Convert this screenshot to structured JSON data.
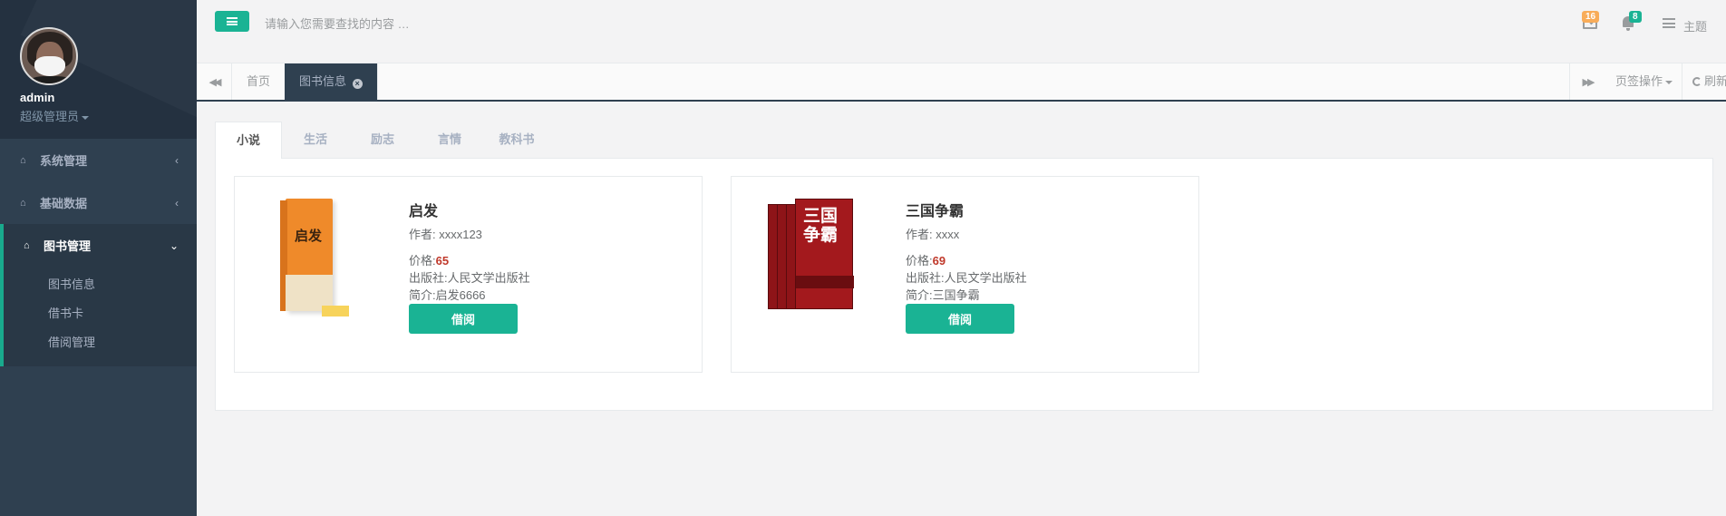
{
  "sidebar": {
    "user_name": "admin",
    "user_role": "超级管理员",
    "menu": [
      {
        "label": "系统管理"
      },
      {
        "label": "基础数据"
      },
      {
        "label": "图书管理",
        "sub_items": [
          "图书信息",
          "借书卡",
          "借阅管理"
        ]
      }
    ]
  },
  "topbar": {
    "search_placeholder": "请输入您需要查找的内容 …",
    "mail_count": "16",
    "notification_count": "8",
    "theme_label": "主题"
  },
  "tabbar": {
    "tabs": [
      "首页",
      "图书信息"
    ],
    "tab_ops_label": "页签操作",
    "refresh_label": "刷新"
  },
  "content": {
    "categories": [
      "小说",
      "生活",
      "励志",
      "言情",
      "教科书"
    ],
    "active_category": "小说",
    "books": [
      {
        "title": "启发",
        "author": "作者: xxxx123",
        "price_label": "价格:",
        "price": "65",
        "publisher": "出版社:人民文学出版社",
        "intro": "简介:启发6666",
        "cover_text": "启发",
        "borrow_label": "借阅"
      },
      {
        "title": "三国争霸",
        "author": "作者: xxxx",
        "price_label": "价格:",
        "price": "69",
        "publisher": "出版社:人民文学出版社",
        "intro": "简介:三国争霸",
        "cover_text": "三国争霸",
        "borrow_label": "借阅"
      }
    ]
  },
  "colors": {
    "sidebar_bg": "#2f4050",
    "accent": "#1ab394",
    "price": "#c0392b",
    "mail_badge": "#f8ac59"
  }
}
